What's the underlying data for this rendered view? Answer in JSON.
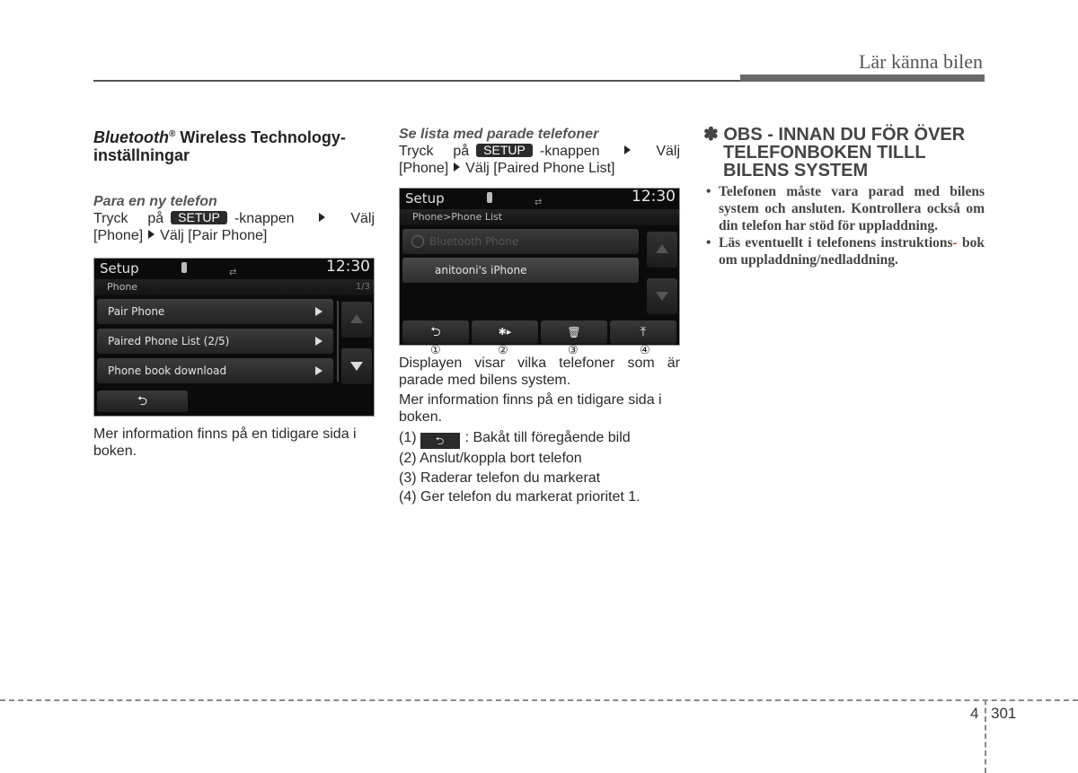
{
  "header": {
    "title": "Lär känna bilen"
  },
  "col1": {
    "title_italic": "Bluetooth",
    "title_sup": "®",
    "title_rest": " Wireless Technology-inställningar",
    "subhead": "Para en ny telefon",
    "line1_pre": "Tryck på",
    "setup_label": "SETUP",
    "line1_post": "-knappen",
    "line1_end": "Välj",
    "line2_a": "[Phone]",
    "line2_b": "Välj [Pair Phone]",
    "after": "Mer information finns på en tidigare sida i boken.",
    "screen": {
      "title": "Setup",
      "time": "12:30",
      "crumb": "Phone",
      "page": "1/3",
      "items": [
        "Pair Phone",
        "Paired Phone List  (2/5)",
        "Phone book download"
      ],
      "back_glyph": "⮌"
    }
  },
  "col2": {
    "subhead": "Se lista med parade telefoner",
    "line1_pre": "Tryck på",
    "setup_label": "SETUP",
    "line1_post": "-knappen",
    "line1_end": "Välj",
    "line2_a": "[Phone]",
    "line2_b": "Välj [Paired Phone List]",
    "screen": {
      "title": "Setup",
      "time": "12:30",
      "crumb": "Phone>Phone List",
      "items": [
        "Bluetooth Phone",
        "anitooni's iPhone"
      ],
      "bottom_buttons": [
        {
          "icon": "back",
          "glyph": "⮌"
        },
        {
          "icon": "bluetooth-connect",
          "glyph": "✱▸"
        },
        {
          "icon": "trash",
          "glyph": "🗑"
        },
        {
          "icon": "priority",
          "glyph": "⤒"
        }
      ],
      "callouts": [
        "①",
        "②",
        "③",
        "④"
      ]
    },
    "para1": "Displayen visar vilka telefoner som är parade med bilens system.",
    "para2": "Mer information finns på en tidigare sida i boken.",
    "list": [
      {
        "num": "(1)",
        "text": ": Bakåt till föregående bild"
      },
      {
        "num": "(2)",
        "text": "Anslut/koppla bort telefon"
      },
      {
        "num": "(3)",
        "text": "Raderar telefon du markerat"
      },
      {
        "num": "(4)",
        "text": "Ger telefon du markerat prioritet 1."
      }
    ]
  },
  "col3": {
    "obs_title": "✽ OBS - INNAN DU FÖR ÖVER TELEFONBOKEN TILLL BILENS SYSTEM",
    "bullets": [
      "Telefonen måste vara parad med bilens system och ansluten. Kontrollera också om din telefon har stöd för uppladdning.",
      "Läs eventuellt i telefonens instruktions"
    ],
    "bullet2_hyphen": "-",
    "bullet2_rest": "bok om uppladdning/nedladdning."
  },
  "footer": {
    "chapter": "4",
    "page": "301"
  }
}
